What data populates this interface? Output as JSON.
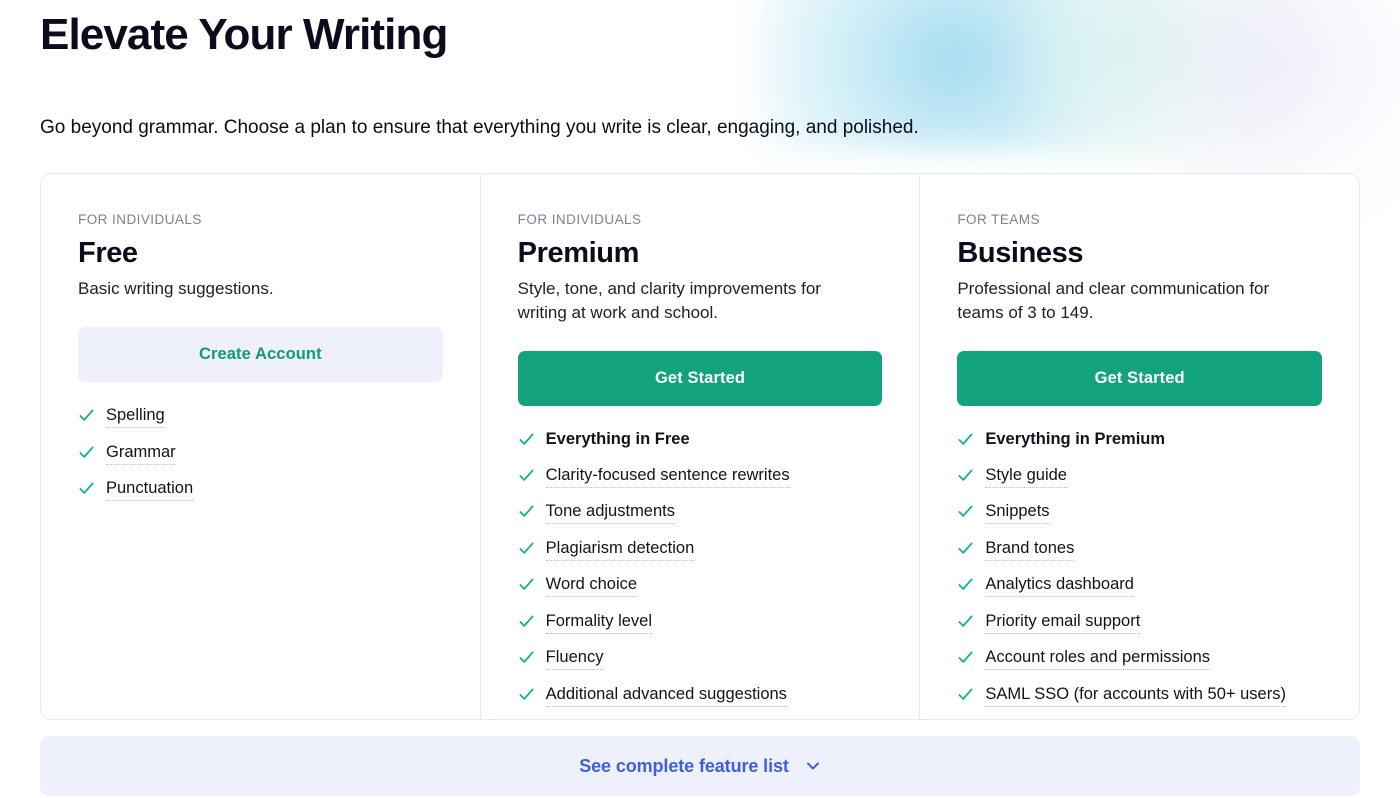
{
  "header": {
    "title": "Elevate Your Writing",
    "subtitle": "Go beyond grammar. Choose a plan to ensure that everything you write is clear, engaging, and polished."
  },
  "colors": {
    "accent_green": "#12a37c",
    "check_green": "#13b488",
    "link_blue": "#3f5fe0",
    "soft_lavender": "#eef1fb",
    "card_border": "#e7e9f2",
    "muted_text": "#7b8296",
    "heading": "#0b0c1b"
  },
  "plans": [
    {
      "audience": "FOR INDIVIDUALS",
      "name": "Free",
      "description": "Basic writing suggestions.",
      "cta_label": "Create Account",
      "cta_style": "secondary",
      "features": [
        {
          "label": "Spelling",
          "bold": false
        },
        {
          "label": "Grammar",
          "bold": false
        },
        {
          "label": "Punctuation",
          "bold": false
        }
      ]
    },
    {
      "audience": "FOR INDIVIDUALS",
      "name": "Premium",
      "description": "Style, tone, and clarity improvements for writing at work and school.",
      "cta_label": "Get Started",
      "cta_style": "primary",
      "features": [
        {
          "label": "Everything in Free",
          "bold": true
        },
        {
          "label": "Clarity-focused sentence rewrites",
          "bold": false
        },
        {
          "label": "Tone adjustments",
          "bold": false
        },
        {
          "label": "Plagiarism detection",
          "bold": false
        },
        {
          "label": "Word choice",
          "bold": false
        },
        {
          "label": "Formality level",
          "bold": false
        },
        {
          "label": "Fluency",
          "bold": false
        },
        {
          "label": "Additional advanced suggestions",
          "bold": false
        }
      ]
    },
    {
      "audience": "FOR TEAMS",
      "name": "Business",
      "description": "Professional and clear communication for teams of 3 to 149.",
      "cta_label": "Get Started",
      "cta_style": "primary",
      "features": [
        {
          "label": "Everything in Premium",
          "bold": true
        },
        {
          "label": "Style guide",
          "bold": false
        },
        {
          "label": "Snippets",
          "bold": false
        },
        {
          "label": "Brand tones",
          "bold": false
        },
        {
          "label": "Analytics dashboard",
          "bold": false
        },
        {
          "label": "Priority email support",
          "bold": false
        },
        {
          "label": "Account roles and permissions",
          "bold": false
        },
        {
          "label": "SAML SSO (for accounts with 50+ users)",
          "bold": false
        }
      ]
    }
  ],
  "footer": {
    "expander_label": "See complete feature list",
    "expander_icon": "chevron-down-icon"
  },
  "icons": {
    "check": "check-icon",
    "chevron_down": "chevron-down-icon"
  }
}
